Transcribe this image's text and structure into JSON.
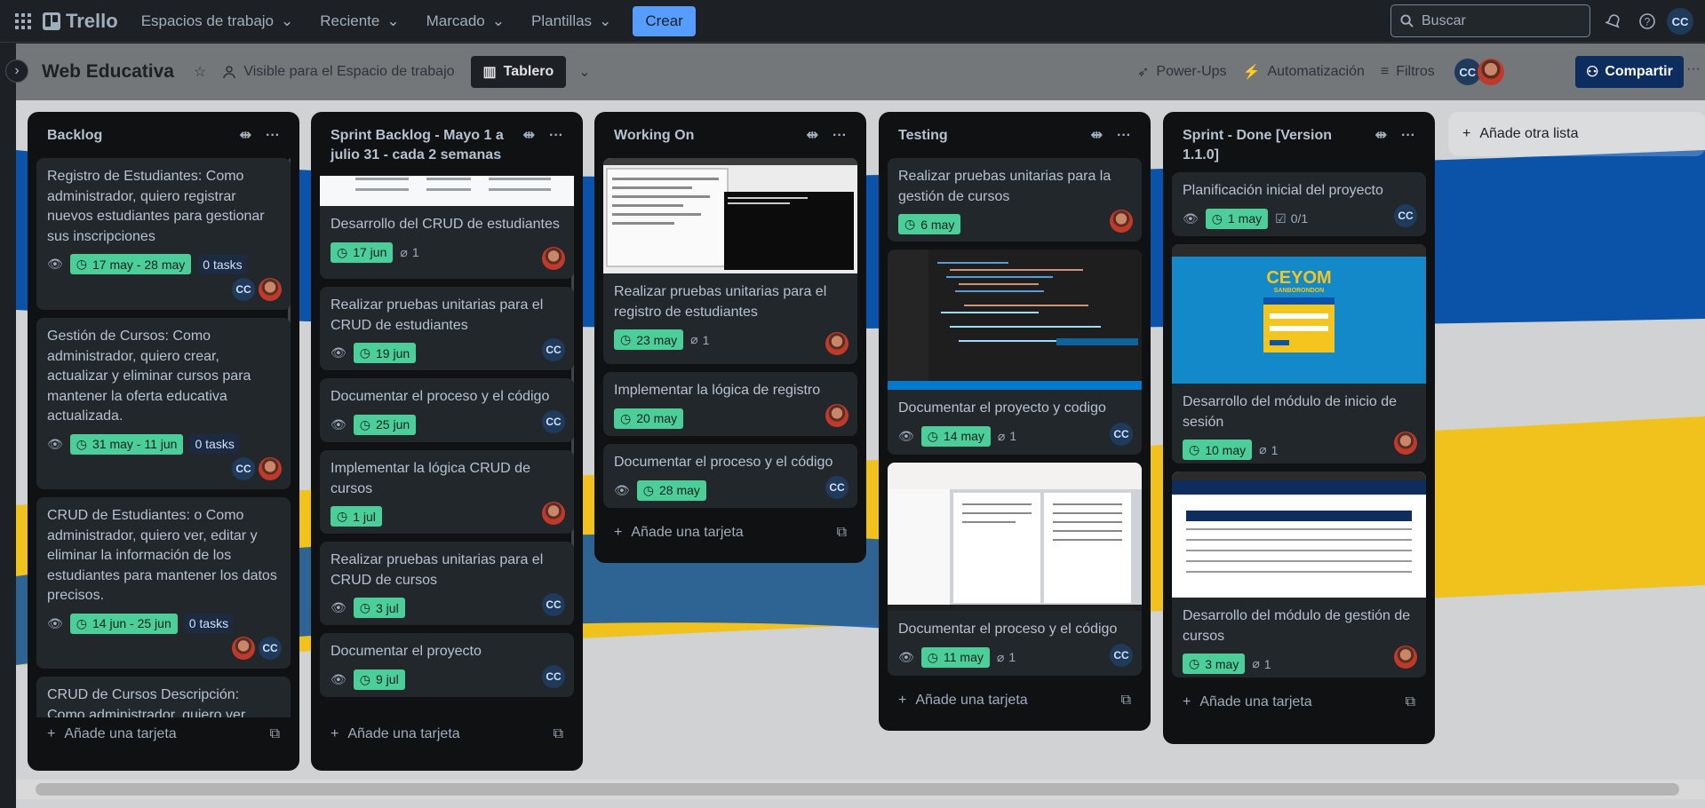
{
  "topbar": {
    "logo": "Trello",
    "nav": [
      "Espacios de trabajo",
      "Reciente",
      "Marcado",
      "Plantillas"
    ],
    "create": "Crear",
    "search_placeholder": "Buscar",
    "avatar": "CC"
  },
  "board": {
    "title": "Web Educativa",
    "visibility": "Visible para el Espacio de trabajo",
    "view": "Tablero",
    "powerups": "Power-Ups",
    "automation": "Automatización",
    "filters": "Filtros",
    "share": "Compartir",
    "member_initials": "CC",
    "add_list": "Añade otra lista",
    "add_card": "Añade una tarjeta"
  },
  "lists": [
    {
      "title": "Backlog",
      "cards": [
        {
          "title": "Registro de Estudiantes: Como administrador, quiero registrar nuevos estudiantes para gestionar sus inscripciones",
          "date": "17 may - 28 may",
          "tasks": "0 tasks",
          "members": [
            "CC",
            "photo"
          ]
        },
        {
          "title": "Gestión de Cursos: Como administrador, quiero crear, actualizar y eliminar cursos para mantener la oferta educativa actualizada.",
          "date": "31 may - 11 jun",
          "tasks": "0 tasks",
          "members": [
            "CC",
            "photo"
          ]
        },
        {
          "title": "CRUD de Estudiantes: o Como administrador, quiero ver, editar y eliminar la información de los estudiantes para mantener los datos precisos.",
          "date": "14 jun - 25 jun",
          "tasks": "0 tasks",
          "members": [
            "photo",
            "CC"
          ]
        },
        {
          "title": "CRUD de Cursos Descripción: Como administrador, quiero ver,"
        }
      ]
    },
    {
      "title": "Sprint Backlog - Mayo 1 a julio 31 - cada 2 semanas",
      "cards": [
        {
          "title": "Desarrollo del CRUD de estudiantes",
          "date": "17 jun",
          "attachments": "1",
          "members": [
            "photo"
          ]
        },
        {
          "title": "Realizar pruebas unitarias para el CRUD de estudiantes",
          "date": "19 jun",
          "members": [
            "CC"
          ]
        },
        {
          "title": "Documentar el proceso y el código",
          "date": "25 jun",
          "members": [
            "CC"
          ]
        },
        {
          "title": "Implementar la lógica CRUD de cursos",
          "date": "1 jul",
          "members": [
            "photo"
          ]
        },
        {
          "title": "Realizar pruebas unitarias para el CRUD de cursos",
          "date": "3 jul",
          "members": [
            "CC"
          ]
        },
        {
          "title": "Documentar el proyecto",
          "date": "9 jul",
          "members": [
            "CC"
          ]
        }
      ]
    },
    {
      "title": "Working On",
      "cards": [
        {
          "title": "Realizar pruebas unitarias para el registro de estudiantes",
          "date": "23 may",
          "attachments": "1",
          "members": [
            "photo"
          ]
        },
        {
          "title": "Implementar la lógica de registro",
          "date": "20 may",
          "members": [
            "photo"
          ]
        },
        {
          "title": "Documentar el proceso y el código",
          "date": "28 may",
          "members": [
            "CC"
          ]
        }
      ]
    },
    {
      "title": "Testing",
      "cards": [
        {
          "title": "Realizar pruebas unitarias para la gestión de cursos",
          "date": "6 may",
          "members": [
            "photo"
          ]
        },
        {
          "title": "Documentar el proyecto y codigo",
          "date": "14 may",
          "attachments": "1",
          "members": [
            "CC"
          ]
        },
        {
          "title": "Documentar el proceso y el código",
          "date": "11 may",
          "attachments": "1",
          "members": [
            "CC"
          ]
        }
      ]
    },
    {
      "title": "Sprint - Done [Version 1.1.0]",
      "cards": [
        {
          "title": "Planificación inicial del proyecto",
          "date": "1 may",
          "checklist": "0/1",
          "members": [
            "CC"
          ]
        },
        {
          "title": "Desarrollo del módulo de inicio de sesión",
          "date": "10 may",
          "attachments": "1",
          "members": [
            "photo"
          ]
        },
        {
          "title": "Desarrollo del módulo de gestión de cursos",
          "date": "3 may",
          "attachments": "1",
          "members": [
            "photo"
          ]
        }
      ]
    }
  ],
  "thumb_text": {
    "ceyom": "CEYOM",
    "ceyom_sub": "SANBORONDON"
  },
  "colors": {
    "accent": "#579dff",
    "date_green": "#4bce97",
    "list_bg": "#101204",
    "card_bg": "#22272b",
    "share_bg": "#0c2d5e"
  }
}
